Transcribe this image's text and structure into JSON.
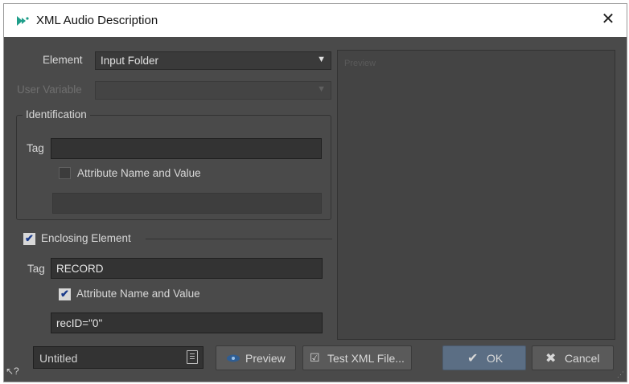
{
  "window": {
    "title": "XML Audio Description",
    "close_label": "✕"
  },
  "form": {
    "element_label": "Element",
    "element_value": "Input Folder",
    "user_variable_label": "User Variable",
    "user_variable_value": "",
    "preview_placeholder": "Preview"
  },
  "identification": {
    "title": "Identification",
    "tag_label": "Tag",
    "tag_value": "",
    "attr_checkbox_label": "Attribute Name and Value",
    "attr_checked": false,
    "attr_value": ""
  },
  "enclosing": {
    "checkbox_label": "Enclosing Element",
    "checked": true,
    "tag_label": "Tag",
    "tag_value": "RECORD",
    "attr_checkbox_label": "Attribute Name and Value",
    "attr_checked": true,
    "attr_value": "recID=\"0\""
  },
  "footer": {
    "name_value": "Untitled",
    "preview_button": "Preview",
    "test_button": "Test XML File...",
    "ok_button": "OK",
    "cancel_button": "Cancel"
  },
  "colors": {
    "background": "#4a4a4a",
    "field": "#333333",
    "primary_button": "#5b6e84"
  }
}
